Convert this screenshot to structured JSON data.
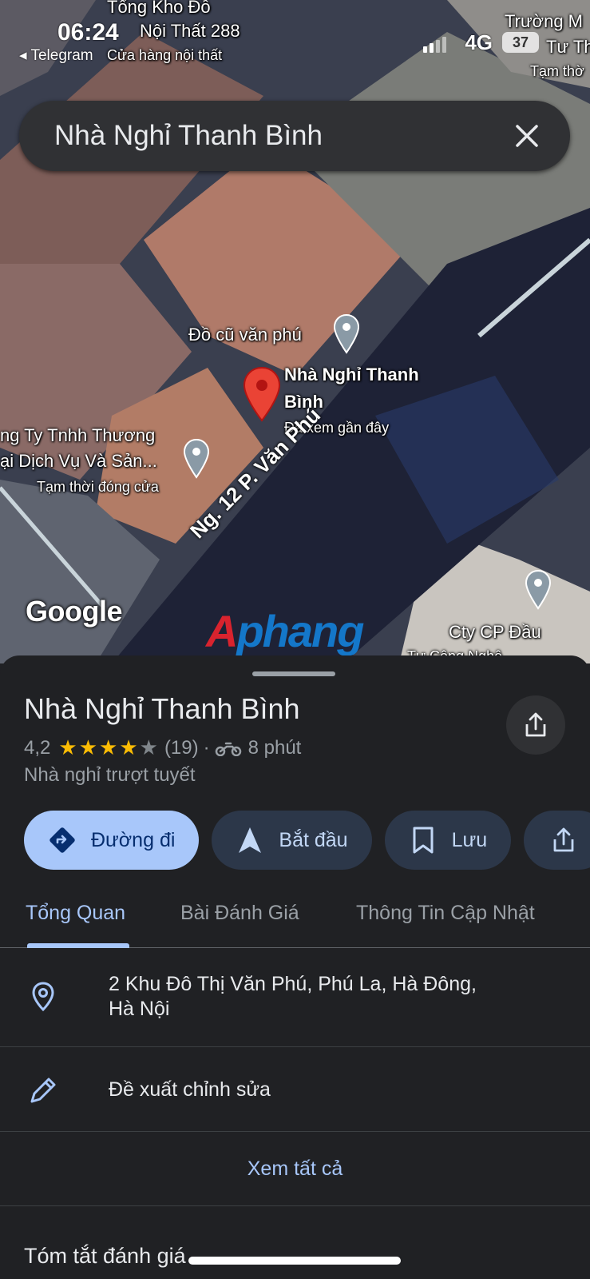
{
  "status_bar": {
    "time": "06:24",
    "back_app": "Telegram",
    "network": "4G",
    "battery": "37"
  },
  "search": {
    "query": "Nhà Nghỉ Thanh Bình"
  },
  "map": {
    "labels": {
      "top_store_1": "Tổng Kho Đồ",
      "top_store_2": "Nội Thất 288",
      "top_store_sub": "Cửa hàng nội thất",
      "top_right_1": "Trường M",
      "top_right_2": "Tư Th",
      "top_right_sub": "Tạm thờ",
      "used_goods": "Đồ cũ văn phú",
      "selected_name_1": "Nhà Nghỉ Thanh",
      "selected_name_2": "Bình",
      "selected_sub": "Đã xem gần đây",
      "company_1": "ng Ty Tnhh Thương",
      "company_2": "ại Dịch Vụ Và Sản...",
      "company_sub": "Tạm thời đóng cửa",
      "road": "Ng. 12 P. Văn Phú",
      "bottom_right_1": "Cty CP Đầu",
      "bottom_right_2": "Tư Công Nghệ"
    },
    "attribution": "Google",
    "watermark_a": "A",
    "watermark_rest": "phang"
  },
  "place": {
    "name": "Nhà Nghỉ Thanh Bình",
    "rating": "4,2",
    "stars_filled": 4,
    "review_count": "(19)",
    "separator": "·",
    "travel_time": "8 phút",
    "category": "Nhà nghỉ trượt tuyết"
  },
  "actions": {
    "directions": "Đường đi",
    "start": "Bắt đầu",
    "save": "Lưu"
  },
  "tabs": {
    "overview": "Tổng Quan",
    "reviews": "Bài Đánh Giá",
    "updates": "Thông Tin Cập Nhật"
  },
  "details": {
    "address_line1": "2 Khu Đô Thị Văn Phú, Phú La, Hà Đông,",
    "address_line2": "Hà Nội",
    "suggest_edit": "Đề xuất chỉnh sửa",
    "see_all": "Xem tất cả",
    "review_summary": "Tóm tắt đánh giá"
  },
  "colors": {
    "accent": "#a8c7fa",
    "pin_red": "#ea4335",
    "star": "#fbbc04"
  }
}
